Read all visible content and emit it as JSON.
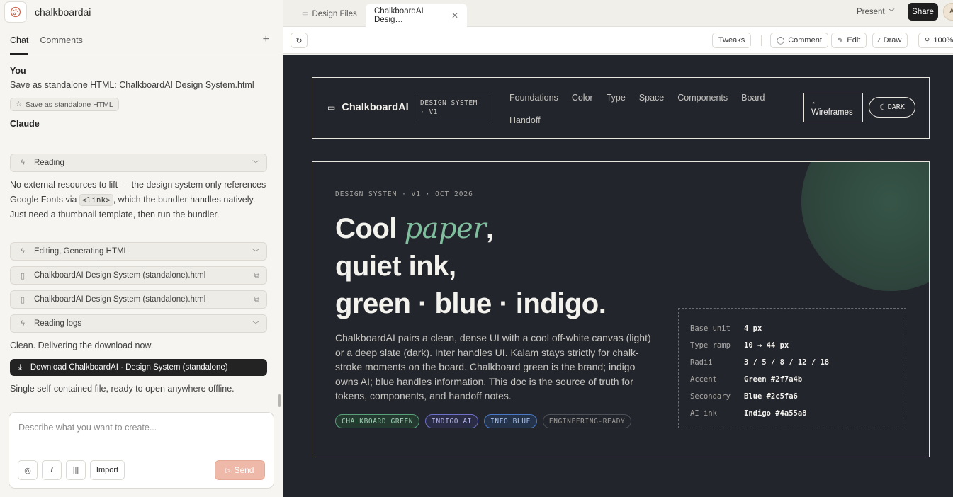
{
  "app": {
    "name": "chalkboardai"
  },
  "panel_tabs": {
    "chat": "Chat",
    "comments": "Comments",
    "add": "+"
  },
  "chat": {
    "user_label": "You",
    "user_message": "Save as standalone HTML: ChalkboardAI Design System.html",
    "user_chip": "Save as standalone HTML",
    "assistant_label": "Claude",
    "row_reading": "Reading",
    "para1_before": "No external resources to lift — the design system only references Google Fonts via ",
    "para1_code": "<link>",
    "para1_after": ", which the bundler handles natively. Just need a thumbnail template, then run the bundler.",
    "row_editing": "Editing, Generating HTML",
    "file1": "ChalkboardAI Design System (standalone).html",
    "file2": "ChalkboardAI Design System (standalone).html",
    "row_logs": "Reading logs",
    "delivering": "Clean. Delivering the download now.",
    "download": "Download ChalkboardAI · Design System (standalone)",
    "closing": "Single self-contained file, ready to open anywhere offline."
  },
  "composer": {
    "placeholder": "Describe what you want to create...",
    "import": "Import",
    "send": "Send"
  },
  "topbar": {
    "tab1": "Design Files",
    "tab2": "ChalkboardAI Desig…",
    "present": "Present",
    "share": "Share",
    "avatar": "A"
  },
  "toolbar": {
    "tweaks": "Tweaks",
    "comment": "Comment",
    "edit": "Edit",
    "draw": "Draw",
    "zoom": "100%"
  },
  "site": {
    "brand": "ChalkboardAI",
    "badge_line1": "DESIGN SYSTEM",
    "badge_line2": "· V1",
    "nav": [
      "Foundations",
      "Color",
      "Type",
      "Space",
      "Components",
      "Board",
      "Handoff"
    ],
    "wireframes_arrow": "←",
    "wireframes": "Wireframes",
    "dark": "DARK"
  },
  "hero": {
    "eyebrow": "DESIGN SYSTEM · V1 · OCT 2026",
    "title_cool": "Cool ",
    "title_paper": "paper",
    "title_comma": ",",
    "title_line2": "quiet ink,",
    "title_line3": "green · blue · indigo.",
    "description": "ChalkboardAI pairs a clean, dense UI with a cool off-white canvas (light) or a deep slate (dark). Inter handles UI. Kalam stays strictly for chalk-stroke moments on the board. Chalkboard green is the brand; indigo owns AI; blue handles information. This doc is the source of truth for tokens, components, and handoff notes.",
    "pills": [
      "CHALKBOARD GREEN",
      "INDIGO AI",
      "INFO BLUE",
      "ENGINEERING-READY"
    ]
  },
  "tokens": [
    {
      "key": "Base unit",
      "value": "4 px"
    },
    {
      "key": "Type ramp",
      "value": "10 → 44 px"
    },
    {
      "key": "Radii",
      "value": "3 / 5 / 8 / 12 / 18"
    },
    {
      "key": "Accent",
      "value": "Green #2f7a4b"
    },
    {
      "key": "Secondary",
      "value": "Blue #2c5fa6"
    },
    {
      "key": "AI ink",
      "value": "Indigo #4a55a8"
    }
  ],
  "colors": {
    "canvas_bg": "#23252c",
    "brand_green": "#2f7a4b",
    "info_blue": "#2c5fa6",
    "ai_indigo": "#4a55a8",
    "send_button": "#eeb9a8"
  }
}
